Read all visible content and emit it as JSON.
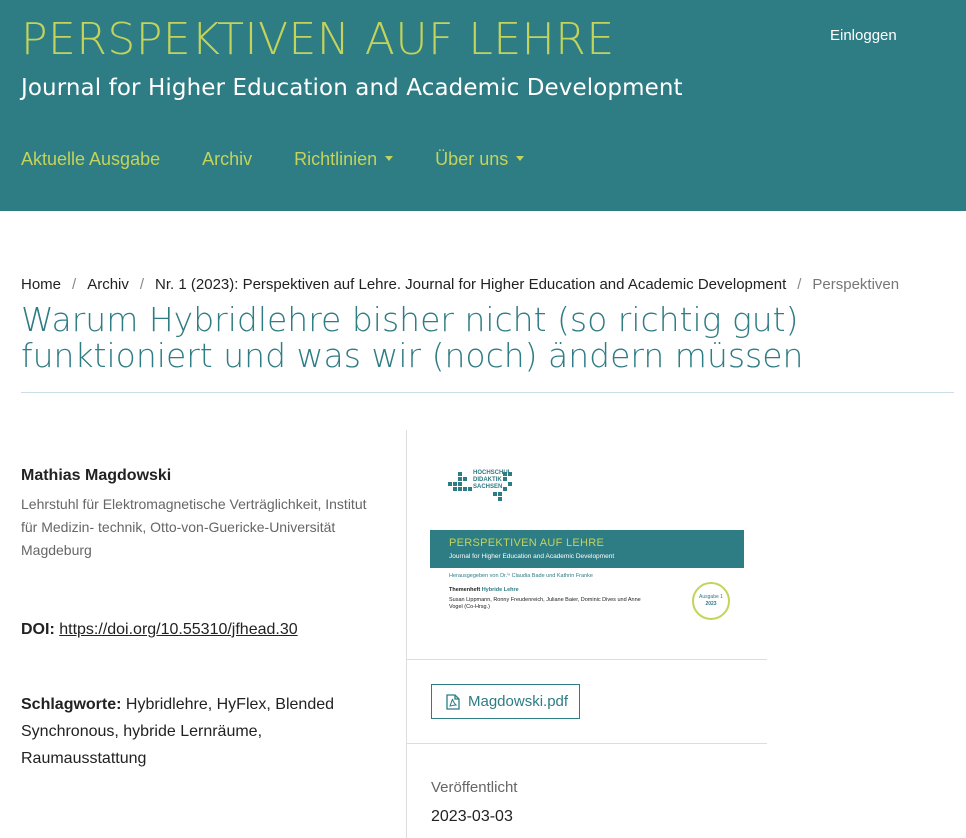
{
  "header": {
    "site_title": "PERSPEKTIVEN AUF LEHRE",
    "site_subtitle": "Journal for Higher Education and Academic Development",
    "login_label": "Einloggen",
    "nav": [
      {
        "label": "Aktuelle Ausgabe",
        "has_dropdown": false
      },
      {
        "label": "Archiv",
        "has_dropdown": false
      },
      {
        "label": "Richtlinien",
        "has_dropdown": true
      },
      {
        "label": "Über uns",
        "has_dropdown": true
      }
    ]
  },
  "breadcrumb": {
    "items": [
      "Home",
      "Archiv",
      "Nr. 1 (2023): Perspektiven auf Lehre. Journal for Higher Education and Academic Development"
    ],
    "separator": "/",
    "current": "Perspektiven"
  },
  "article": {
    "title": "Warum Hybridlehre bisher nicht (so richtig gut) funktioniert und was wir (noch) ändern müssen",
    "author": {
      "name": "Mathias Magdowski",
      "affiliation": "Lehrstuhl für Elektromagnetische Verträglichkeit, Institut für Medizin- technik, Otto-von-Guericke-Universität Magdeburg"
    },
    "doi": {
      "label": "DOI:",
      "url": "https://doi.org/10.55310/jfhead.30"
    },
    "keywords": {
      "label": "Schlagworte:",
      "value": "Hybridlehre, HyFlex, Blended Synchronous, hybride Lernräume, Raumausstattung"
    }
  },
  "cover": {
    "logo_text": "HOCHSCHUL DIDAKTIK SACHSEN",
    "band_title": "PERSPEKTIVEN AUF LEHRE",
    "band_subtitle": "Journal for Higher Education and Academic Development",
    "editors": "Herausgegeben von Dr.ⁱⁿ Claudia Bade und Kathrin Franke",
    "themenheft_label": "Themenheft",
    "themenheft_value": "Hybride Lehre",
    "authors": "Susan Lippmann, Ronny Freudenreich, Juliane Baier, Dominic Dives und Anne Vogel (Co-Hrsg.)",
    "badge_line1": "Ausgabe 1",
    "badge_line2": "2023"
  },
  "galley": {
    "pdf_label": "Magdowski.pdf"
  },
  "published": {
    "label": "Veröffentlicht",
    "date": "2023-03-03"
  },
  "colors": {
    "primary": "#2e7c84",
    "accent": "#c4d35a"
  }
}
